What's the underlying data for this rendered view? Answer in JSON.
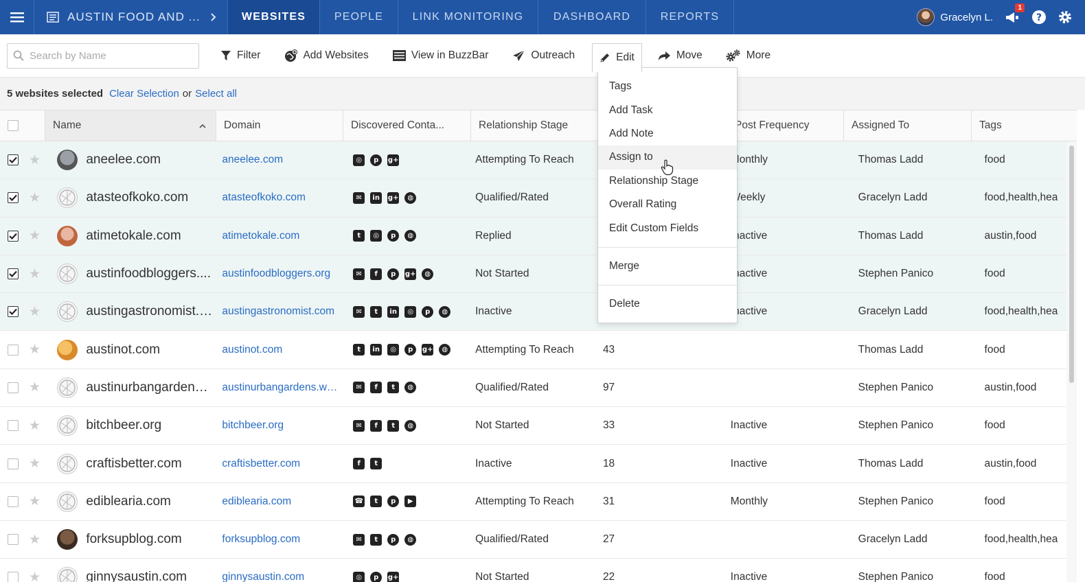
{
  "nav": {
    "project": "AUSTIN FOOD AND ...",
    "tabs": [
      "WEBSITES",
      "PEOPLE",
      "LINK MONITORING",
      "DASHBOARD",
      "REPORTS"
    ],
    "active_tab": "WEBSITES",
    "user": "Gracelyn L.",
    "notification_count": "1"
  },
  "toolbar": {
    "search_placeholder": "Search by Name",
    "filter": "Filter",
    "add_websites": "Add Websites",
    "view_buzzbar": "View in BuzzBar",
    "outreach": "Outreach",
    "edit": "Edit",
    "move": "Move",
    "more": "More"
  },
  "selection": {
    "count_text": "5 websites selected",
    "clear": "Clear Selection",
    "or": "or",
    "select_all": "Select all"
  },
  "columns": [
    "Name",
    "Domain",
    "Discovered Conta...",
    "Relationship Stage",
    "",
    "Post Frequency",
    "Assigned To",
    "Tags"
  ],
  "edit_menu": {
    "items": [
      "Tags",
      "Add Task",
      "Add Note",
      "Assign to",
      "Relationship Stage",
      "Overall Rating",
      "Edit Custom Fields"
    ],
    "merge": "Merge",
    "delete": "Delete",
    "hovered": "Assign to"
  },
  "rows": [
    {
      "name": "aneelee.com",
      "domain": "aneelee.com",
      "contacts": [
        "instagram",
        "pinterest",
        "googleplus"
      ],
      "stage": "Attempting To Reach",
      "rating": "",
      "freq": "Monthly",
      "assigned": "Thomas Ladd",
      "tags": "food",
      "selected": true
    },
    {
      "name": "atasteofkoko.com",
      "domain": "atasteofkoko.com",
      "contacts": [
        "email",
        "linkedin",
        "googleplus",
        "web"
      ],
      "stage": "Qualified/Rated",
      "rating": "",
      "freq": "Weekly",
      "assigned": "Gracelyn Ladd",
      "tags": "food,health,hea",
      "selected": true
    },
    {
      "name": "atimetokale.com",
      "domain": "atimetokale.com",
      "contacts": [
        "twitter",
        "instagram",
        "pinterest",
        "web"
      ],
      "stage": "Replied",
      "rating": "",
      "freq": "Inactive",
      "assigned": "Thomas Ladd",
      "tags": "austin,food",
      "selected": true
    },
    {
      "name": "austinfoodbloggers....",
      "domain": "austinfoodbloggers.org",
      "contacts": [
        "email",
        "facebook",
        "pinterest",
        "googleplus",
        "web"
      ],
      "stage": "Not Started",
      "rating": "",
      "freq": "Inactive",
      "assigned": "Stephen Panico",
      "tags": "food",
      "selected": true
    },
    {
      "name": "austingastronomist.c...",
      "domain": "austingastronomist.com",
      "contacts": [
        "email",
        "twitter",
        "linkedin",
        "instagram",
        "pinterest",
        "web"
      ],
      "stage": "Inactive",
      "rating": "",
      "freq": "Inactive",
      "assigned": "Gracelyn Ladd",
      "tags": "food,health,hea",
      "selected": true
    },
    {
      "name": "austinot.com",
      "domain": "austinot.com",
      "contacts": [
        "twitter",
        "linkedin",
        "instagram",
        "pinterest",
        "googleplus",
        "web"
      ],
      "stage": "Attempting To Reach",
      "rating": "43",
      "freq": "",
      "assigned": "Thomas Ladd",
      "tags": "food",
      "selected": false
    },
    {
      "name": "austinurbangardens....",
      "domain": "austinurbangardens.wo...",
      "contacts": [
        "email",
        "facebook",
        "twitter",
        "web"
      ],
      "stage": "Qualified/Rated",
      "rating": "97",
      "freq": "",
      "assigned": "Stephen Panico",
      "tags": "austin,food",
      "selected": false
    },
    {
      "name": "bitchbeer.org",
      "domain": "bitchbeer.org",
      "contacts": [
        "email",
        "facebook",
        "twitter",
        "web"
      ],
      "stage": "Not Started",
      "rating": "33",
      "freq": "Inactive",
      "assigned": "Stephen Panico",
      "tags": "food",
      "selected": false
    },
    {
      "name": "craftisbetter.com",
      "domain": "craftisbetter.com",
      "contacts": [
        "facebook",
        "twitter"
      ],
      "stage": "Inactive",
      "rating": "18",
      "freq": "Inactive",
      "assigned": "Thomas Ladd",
      "tags": "austin,food",
      "selected": false
    },
    {
      "name": "ediblearia.com",
      "domain": "ediblearia.com",
      "contacts": [
        "phone",
        "twitter",
        "pinterest",
        "youtube"
      ],
      "stage": "Attempting To Reach",
      "rating": "31",
      "freq": "Monthly",
      "assigned": "Stephen Panico",
      "tags": "food",
      "selected": false
    },
    {
      "name": "forksupblog.com",
      "domain": "forksupblog.com",
      "contacts": [
        "email",
        "twitter",
        "pinterest",
        "web"
      ],
      "stage": "Qualified/Rated",
      "rating": "27",
      "freq": "",
      "assigned": "Gracelyn Ladd",
      "tags": "food,health,hea",
      "selected": false
    },
    {
      "name": "ginnysaustin.com",
      "domain": "ginnysaustin.com",
      "contacts": [
        "instagram",
        "pinterest",
        "googleplus"
      ],
      "stage": "Not Started",
      "rating": "22",
      "freq": "Inactive",
      "assigned": "Stephen Panico",
      "tags": "food",
      "selected": false
    }
  ]
}
